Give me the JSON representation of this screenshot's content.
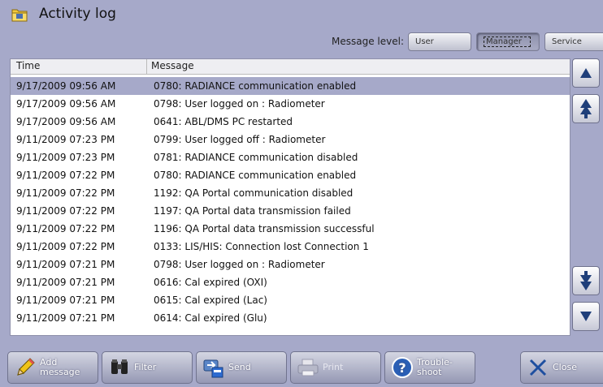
{
  "window": {
    "title": "Activity log",
    "icon": "folder-icon"
  },
  "message_level": {
    "label": "Message level:",
    "options": [
      "User",
      "Manager",
      "Service"
    ],
    "selected": "Manager"
  },
  "log": {
    "columns": {
      "time": "Time",
      "message": "Message"
    },
    "selected_row": 0,
    "rows": [
      {
        "time": "9/17/2009 09:56 AM",
        "message": "0780: RADIANCE communication enabled"
      },
      {
        "time": "9/17/2009 09:56 AM",
        "message": "0798: User logged on : Radiometer"
      },
      {
        "time": "9/17/2009 09:56 AM",
        "message": "0641: ABL/DMS PC restarted"
      },
      {
        "time": "9/11/2009 07:23 PM",
        "message": "0799: User logged off : Radiometer"
      },
      {
        "time": "9/11/2009 07:23 PM",
        "message": "0781: RADIANCE communication disabled"
      },
      {
        "time": "9/11/2009 07:22 PM",
        "message": "0780: RADIANCE communication enabled"
      },
      {
        "time": "9/11/2009 07:22 PM",
        "message": "1192: QA Portal communication disabled"
      },
      {
        "time": "9/11/2009 07:22 PM",
        "message": "1197: QA Portal data transmission failed"
      },
      {
        "time": "9/11/2009 07:22 PM",
        "message": "1196: QA Portal data transmission successful"
      },
      {
        "time": "9/11/2009 07:22 PM",
        "message": "0133: LIS/HIS: Connection lost Connection 1"
      },
      {
        "time": "9/11/2009 07:21 PM",
        "message": "0798: User logged on : Radiometer"
      },
      {
        "time": "9/11/2009 07:21 PM",
        "message": "0616: Cal expired (OXI)"
      },
      {
        "time": "9/11/2009 07:21 PM",
        "message": "0615: Cal expired (Lac)"
      },
      {
        "time": "9/11/2009 07:21 PM",
        "message": "0614: Cal expired (Glu)"
      }
    ]
  },
  "scroll_buttons": [
    "arrow-up-icon",
    "double-arrow-up-icon",
    "double-arrow-down-icon",
    "arrow-down-icon"
  ],
  "toolbar": {
    "add_message": {
      "line1": "Add",
      "line2": "message",
      "icon": "pencil-icon"
    },
    "filter": {
      "label": "Filter",
      "icon": "binoculars-icon"
    },
    "send": {
      "label": "Send",
      "icon": "send-icon"
    },
    "print": {
      "label": "Print",
      "icon": "printer-icon",
      "enabled": false
    },
    "troubleshoot": {
      "line1": "Trouble-",
      "line2": "shoot",
      "icon": "help-icon"
    },
    "close": {
      "label": "Close",
      "icon": "close-icon"
    }
  },
  "colors": {
    "background": "#a6a9c9",
    "selected_row": "#a6a9c9",
    "scroll_arrow": "#1f3f7a"
  }
}
